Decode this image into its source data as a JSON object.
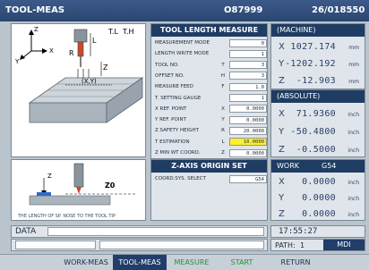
{
  "title_bar": {
    "mode_title": "TOOL-MEAS",
    "program_number": "O87999",
    "sequence": "26/018550"
  },
  "diagram_top": {
    "label_tl": "T.L",
    "label_th": "T.H",
    "label_l": "L",
    "label_r": "R",
    "label_z": "Z",
    "label_xy": "(X,Y)",
    "axis_x": "X",
    "axis_y": "Y",
    "axis_z": "Z"
  },
  "diagram_bottom": {
    "label_z0": "Z0",
    "label_z": "Z",
    "caption": "THE LENGTH OF SP. NOSE TO THE TOOL TIP"
  },
  "tool_length_measure": {
    "header": "TOOL LENGTH MEASURE",
    "params": [
      {
        "label": "MEASUREMENT MODE",
        "key": "",
        "value": "0",
        "highlight": false
      },
      {
        "label": "LENGTH WRITE MODE",
        "key": "",
        "value": "1",
        "highlight": false
      },
      {
        "label": "TOOL NO.",
        "key": "T",
        "value": "3",
        "highlight": false
      },
      {
        "label": "OFFSET NO.",
        "key": "H",
        "value": "3",
        "highlight": false
      },
      {
        "label": "MEASURE FEED",
        "key": "F",
        "value": "1.0",
        "highlight": false
      },
      {
        "label": "T. SETTING GAUGE",
        "key": "",
        "value": "1",
        "highlight": false
      },
      {
        "label": "X REF. POINT",
        "key": "X",
        "value": "0.0000",
        "highlight": false
      },
      {
        "label": "Y REF. POINT",
        "key": "Y",
        "value": "0.0000",
        "highlight": false
      },
      {
        "label": "Z SAFETY HEIGHT",
        "key": "R",
        "value": "20.0000",
        "highlight": false
      },
      {
        "label": "T ESTIMATION",
        "key": "L",
        "value": "10.0000",
        "highlight": true
      },
      {
        "label": "Z MIN WT COORD.",
        "key": "Z",
        "value": "0.0000",
        "highlight": false
      }
    ]
  },
  "z_axis_origin_set": {
    "header": "Z-AXIS ORIGIN SET",
    "coord_sys_label": "COORD.SYS. SELECT",
    "coord_sys_value": "G54"
  },
  "machine": {
    "header": "(MACHINE)",
    "rows": [
      {
        "axis": "X",
        "value": "1027.174",
        "unit": "mm"
      },
      {
        "axis": "Y",
        "value": "-1202.192",
        "unit": "mm"
      },
      {
        "axis": "Z",
        "value": "-12.903",
        "unit": "mm"
      }
    ]
  },
  "absolute": {
    "header": "(ABSOLUTE)",
    "rows": [
      {
        "axis": "X",
        "value": "71.9360",
        "unit": "inch"
      },
      {
        "axis": "Y",
        "value": "-50.4800",
        "unit": "inch"
      },
      {
        "axis": "Z",
        "value": "-0.5000",
        "unit": "inch"
      }
    ]
  },
  "work": {
    "header_label": "WORK",
    "header_value": "G54",
    "rows": [
      {
        "axis": "X",
        "value": "0.0000",
        "unit": "inch"
      },
      {
        "axis": "Y",
        "value": "0.0000",
        "unit": "inch"
      },
      {
        "axis": "Z",
        "value": "0.0000",
        "unit": "inch"
      }
    ]
  },
  "status": {
    "data_label": "DATA",
    "time": "17:55:27",
    "path_label": "PATH:",
    "path_value": "1",
    "mode": "MDI"
  },
  "softkeys": [
    "WORK-MEAS",
    "TOOL-MEAS",
    "MEASURE",
    "START",
    "RETURN"
  ],
  "colors": {
    "header_bg": "#1f3c63",
    "highlight": "#ffef2a",
    "active_softkey": "#223d6a",
    "green_softkey": "#2c8c3c"
  }
}
